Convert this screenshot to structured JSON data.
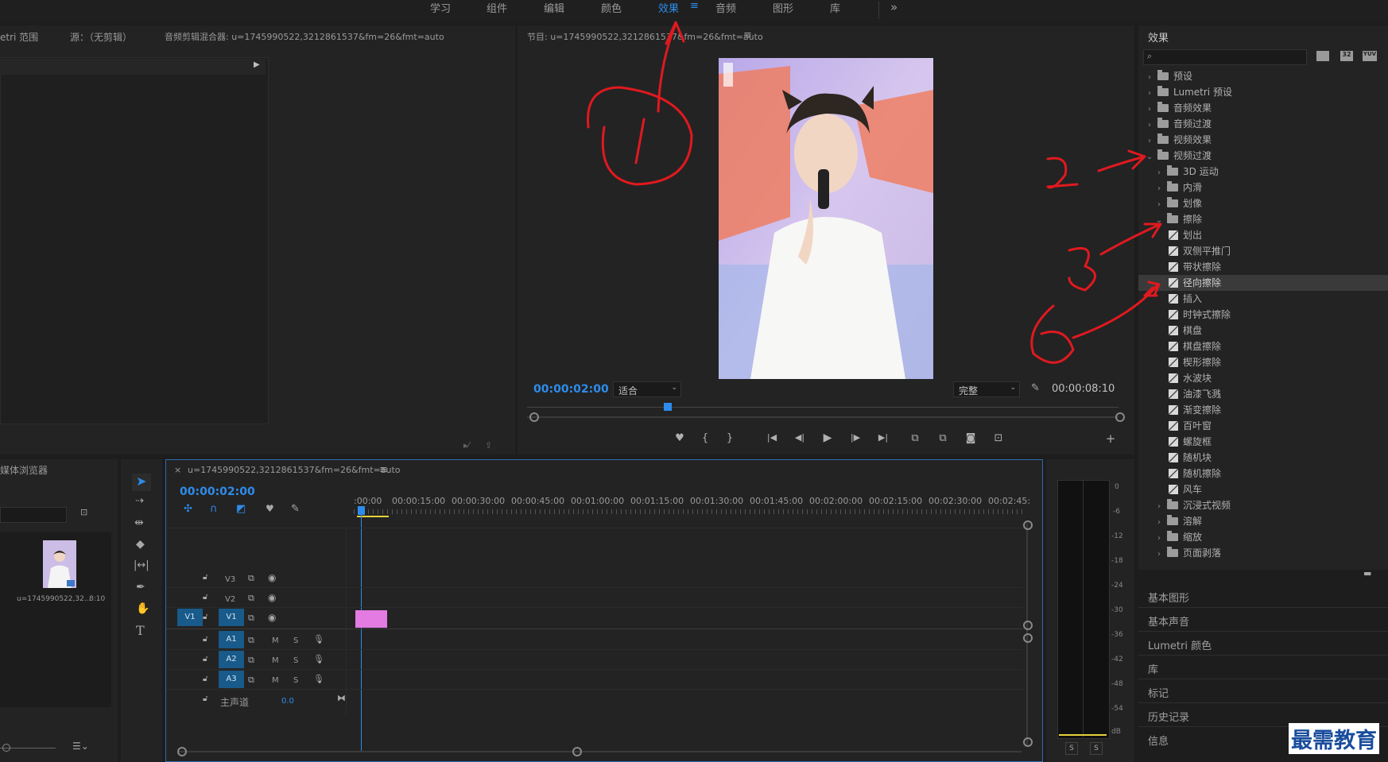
{
  "workspaces": [
    "学习",
    "组件",
    "编辑",
    "颜色",
    "效果",
    "音频",
    "图形",
    "库"
  ],
  "active_workspace": "效果",
  "workspace_more": "»",
  "source_panel": {
    "tabs": [
      "etri 范围",
      "源：（无剪辑）",
      "音频剪辑混合器: u=1745990522,3212861537&fm=26&fmt=auto"
    ]
  },
  "program": {
    "title": "节目: u=1745990522,3212861537&fm=26&fmt=auto",
    "menu": "≡",
    "timecode": "00:00:02:00",
    "fit": "适合",
    "quality": "完整",
    "duration": "00:00:08:10",
    "controls": [
      "♥",
      "{",
      "}",
      "|◀",
      "◀|",
      "▶",
      "|▶",
      "▶|",
      "⧉",
      "⧉",
      "◙",
      "⊡",
      "+"
    ]
  },
  "media": {
    "title": "媒体浏览器",
    "item_name": "u=1745990522,32...",
    "item_duration": "8:10"
  },
  "timeline": {
    "close": "×",
    "title": "u=1745990522,3212861537&fm=26&fmt=auto",
    "menu": "≡",
    "timecode": "00:00:02:00",
    "ruler": [
      ":00:00",
      "00:00:15:00",
      "00:00:30:00",
      "00:00:45:00",
      "00:01:00:00",
      "00:01:15:00",
      "00:01:30:00",
      "00:01:45:00",
      "00:02:00:00",
      "00:02:15:00",
      "00:02:30:00",
      "00:02:45:"
    ],
    "video_tracks": [
      "V3",
      "V2",
      "V1"
    ],
    "audio_tracks": [
      "A1",
      "A2",
      "A3"
    ],
    "source_patch": "V1",
    "mute": "M",
    "solo": "S",
    "master_label": "主声道",
    "master_value": "0.0"
  },
  "effects": {
    "title": "效果",
    "search_placeholder": "",
    "badges": [
      "32",
      "YUV"
    ],
    "items": [
      {
        "label": "预设",
        "level": 0,
        "type": "folder",
        "open": false
      },
      {
        "label": "Lumetri 预设",
        "level": 0,
        "type": "folder",
        "open": false
      },
      {
        "label": "音频效果",
        "level": 0,
        "type": "folder",
        "open": false
      },
      {
        "label": "音频过渡",
        "level": 0,
        "type": "folder",
        "open": false
      },
      {
        "label": "视频效果",
        "level": 0,
        "type": "folder",
        "open": false
      },
      {
        "label": "视频过渡",
        "level": 0,
        "type": "folder",
        "open": true
      },
      {
        "label": "3D 运动",
        "level": 1,
        "type": "folder",
        "open": false
      },
      {
        "label": "内滑",
        "level": 1,
        "type": "folder",
        "open": false
      },
      {
        "label": "划像",
        "level": 1,
        "type": "folder",
        "open": false
      },
      {
        "label": "擦除",
        "level": 1,
        "type": "folder",
        "open": true
      },
      {
        "label": "划出",
        "level": 2,
        "type": "effect"
      },
      {
        "label": "双侧平推门",
        "level": 2,
        "type": "effect"
      },
      {
        "label": "带状擦除",
        "level": 2,
        "type": "effect"
      },
      {
        "label": "径向擦除",
        "level": 2,
        "type": "effect",
        "selected": true
      },
      {
        "label": "插入",
        "level": 2,
        "type": "effect"
      },
      {
        "label": "时钟式擦除",
        "level": 2,
        "type": "effect"
      },
      {
        "label": "棋盘",
        "level": 2,
        "type": "effect"
      },
      {
        "label": "棋盘擦除",
        "level": 2,
        "type": "effect"
      },
      {
        "label": "楔形擦除",
        "level": 2,
        "type": "effect"
      },
      {
        "label": "水波块",
        "level": 2,
        "type": "effect"
      },
      {
        "label": "油漆飞溅",
        "level": 2,
        "type": "effect"
      },
      {
        "label": "渐变擦除",
        "level": 2,
        "type": "effect"
      },
      {
        "label": "百叶窗",
        "level": 2,
        "type": "effect"
      },
      {
        "label": "螺旋框",
        "level": 2,
        "type": "effect"
      },
      {
        "label": "随机块",
        "level": 2,
        "type": "effect"
      },
      {
        "label": "随机擦除",
        "level": 2,
        "type": "effect"
      },
      {
        "label": "风车",
        "level": 2,
        "type": "effect"
      },
      {
        "label": "沉浸式视频",
        "level": 1,
        "type": "folder",
        "open": false
      },
      {
        "label": "溶解",
        "level": 1,
        "type": "folder",
        "open": false
      },
      {
        "label": "缩放",
        "level": 1,
        "type": "folder",
        "open": false
      },
      {
        "label": "页面剥落",
        "level": 1,
        "type": "folder",
        "open": false
      }
    ]
  },
  "bottom_panels": [
    "基本图形",
    "基本声音",
    "Lumetri 颜色",
    "库",
    "标记",
    "历史记录",
    "信息"
  ],
  "meter": {
    "scale": [
      "0",
      "-6",
      "-12",
      "-18",
      "-24",
      "-30",
      "-36",
      "-42",
      "-48",
      "-54",
      "dB"
    ],
    "solo": "S"
  },
  "watermark": "最需教育",
  "annotations": [
    "1",
    "2",
    "3",
    "4"
  ],
  "colors": {
    "accent": "#2d8ceb",
    "clip": "#e37be3",
    "annotation": "#e0191f",
    "track_on": "#185a89"
  }
}
